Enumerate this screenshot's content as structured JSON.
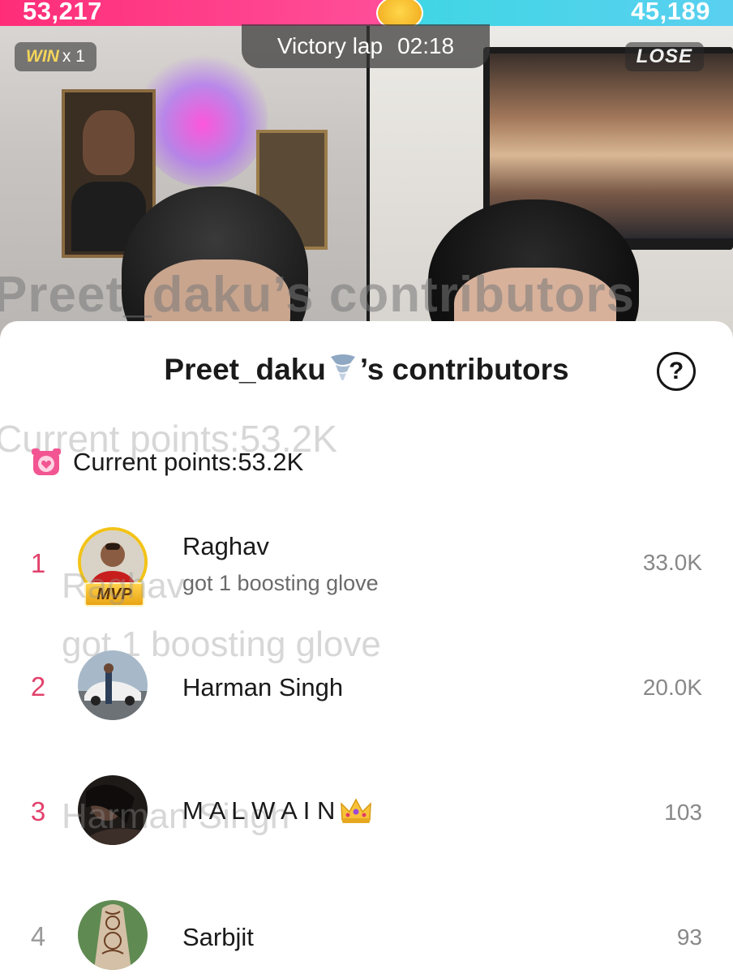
{
  "battle": {
    "left_score": "53,217",
    "right_score": "45,189",
    "win_label": "WIN",
    "win_multiplier": "x 1",
    "lose_label": "LOSE",
    "victory_label": "Victory lap",
    "victory_timer": "02:18",
    "colors": {
      "left": "#ff2d78",
      "right": "#3fd6e4"
    }
  },
  "sheet": {
    "title_prefix": "Preet_daku",
    "title_suffix": "’s contributors",
    "title_emoji_icon": "tornado-icon",
    "help_label": "?",
    "points_label": "Current points:53.2K",
    "points_icon": "alarm-clock-icon",
    "accent_color": "#e2416b"
  },
  "contributors": [
    {
      "rank": "1",
      "name": "Raghav",
      "subtitle": "got 1 boosting glove",
      "score": "33.0K",
      "badge": "MVP"
    },
    {
      "rank": "2",
      "name": "Harman Singh",
      "score": "20.0K"
    },
    {
      "rank": "3",
      "name": "M A L W A I N",
      "score": "103",
      "name_emoji_icon": "crown-icon"
    },
    {
      "rank": "4",
      "name": "Sarbjit",
      "score": "93"
    }
  ]
}
